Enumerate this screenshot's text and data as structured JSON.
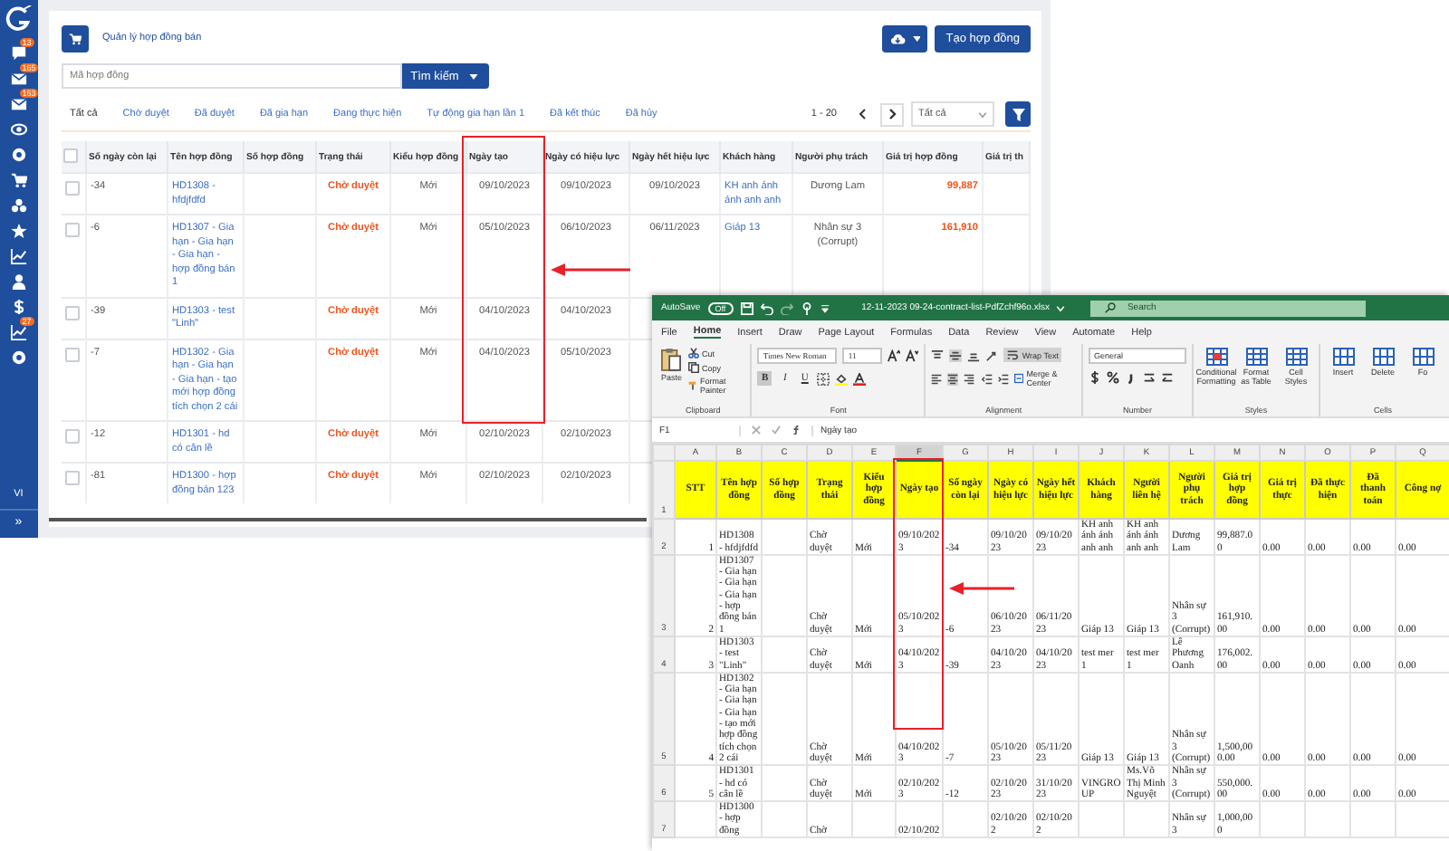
{
  "sidebar": {
    "items": [
      {
        "kind": "chat",
        "badge": "13"
      },
      {
        "kind": "mail",
        "badge": "165"
      },
      {
        "kind": "mail",
        "badge": "163"
      },
      {
        "kind": "eye"
      },
      {
        "kind": "gear"
      },
      {
        "kind": "cart"
      },
      {
        "kind": "group"
      },
      {
        "kind": "star"
      },
      {
        "kind": "chart"
      },
      {
        "kind": "user"
      },
      {
        "kind": "dollar"
      },
      {
        "kind": "chart",
        "badge": "27"
      },
      {
        "kind": "gear"
      }
    ],
    "language": "VI",
    "collapse": "»"
  },
  "page": {
    "title": "Quản lý hợp đồng bán",
    "create_button": "Tạo hợp đồng"
  },
  "search": {
    "placeholder": "Mã hợp đồng",
    "button": "Tìm kiếm"
  },
  "tabs": [
    {
      "label": "Tất cả",
      "selected": true
    },
    {
      "label": "Chờ duyệt",
      "selected": false
    },
    {
      "label": "Đã duyệt",
      "selected": false
    },
    {
      "label": "Đã gia hạn",
      "selected": false
    },
    {
      "label": "Đang thực hiện",
      "selected": false
    },
    {
      "label": "Tự động gia hạn lần 1",
      "selected": false
    },
    {
      "label": "Đã kết thúc",
      "selected": false
    },
    {
      "label": "Đã hủy",
      "selected": false
    }
  ],
  "pagination": {
    "range": "1 - 20",
    "page_size": "Tất cả"
  },
  "table": {
    "select_all_checked": false,
    "columns": [
      "Số ngày còn lại",
      "Tên hợp đồng",
      "Số hợp đồng",
      "Trạng thái",
      "Kiểu hợp đồng",
      "Ngày tạo",
      "Ngày có hiệu lực",
      "Ngày hết hiệu lực",
      "Khách hàng",
      "Người phụ trách",
      "Giá trị hợp đồng",
      "Giá trị th"
    ],
    "rows": [
      {
        "checked": false,
        "days_left": "-34",
        "name": "HD1308 - hfdjfdfd",
        "status": "Chờ duyệt",
        "type": "Mới",
        "created": "09/10/2023",
        "effective": "09/10/2023",
        "expiry": "09/10/2023",
        "customer": "KH anh ánh ánh anh anh",
        "owner": "Dương Lam",
        "value": "99,887"
      },
      {
        "checked": false,
        "days_left": "-6",
        "name": "HD1307 - Gia hạn - Gia hạn - Gia hạn - hợp đồng bán 1",
        "status": "Chờ duyệt",
        "type": "Mới",
        "created": "05/10/2023",
        "effective": "06/10/2023",
        "expiry": "06/11/2023",
        "customer": "Giáp 13",
        "owner": "Nhân sự 3 (Corrupt)",
        "value": "161,910"
      },
      {
        "checked": false,
        "days_left": "-39",
        "name": "HD1303 - test \"Linh\"",
        "status": "Chờ duyệt",
        "type": "Mới",
        "created": "04/10/2023",
        "effective": "04/10/2023"
      },
      {
        "checked": false,
        "days_left": "-7",
        "name": "HD1302 - Gia hạn - Gia hạn - Gia hạn - tạo mới hợp đồng tích chọn 2 cái",
        "status": "Chờ duyệt",
        "type": "Mới",
        "created": "04/10/2023",
        "effective": "05/10/2023"
      },
      {
        "checked": false,
        "days_left": "-12",
        "name": "HD1301 - hd có cân lề",
        "status": "Chờ duyệt",
        "type": "Mới",
        "created": "02/10/2023",
        "effective": "02/10/2023"
      },
      {
        "checked": false,
        "days_left": "-81",
        "name": "HD1300 - hợp đồng bán 123",
        "status": "Chờ duyệt",
        "type": "Mới",
        "created": "02/10/2023",
        "effective": "02/10/2023"
      }
    ]
  },
  "excel": {
    "title_bar": {
      "autosave": {
        "label": "AutoSave",
        "on": false,
        "state_text": "Off"
      },
      "filename": "12-11-2023 09-24-contract-list-PdfZchf96o.xlsx",
      "search_placeholder": "Search"
    },
    "menu": [
      {
        "label": "File",
        "selected": false
      },
      {
        "label": "Home",
        "selected": true
      },
      {
        "label": "Insert",
        "selected": false
      },
      {
        "label": "Draw",
        "selected": false
      },
      {
        "label": "Page Layout",
        "selected": false
      },
      {
        "label": "Formulas",
        "selected": false
      },
      {
        "label": "Data",
        "selected": false
      },
      {
        "label": "Review",
        "selected": false
      },
      {
        "label": "View",
        "selected": false
      },
      {
        "label": "Automate",
        "selected": false
      },
      {
        "label": "Help",
        "selected": false
      }
    ],
    "ribbon": {
      "clipboard": {
        "label": "Clipboard",
        "paste": "Paste",
        "cut": "Cut",
        "copy": "Copy",
        "format_painter": "Format Painter"
      },
      "font": {
        "label": "Font",
        "family": "Times New Roman",
        "size": "11",
        "styles": [
          {
            "label": "B",
            "on": true
          },
          {
            "label": "I",
            "on": false
          },
          {
            "label": "U",
            "on": false
          }
        ]
      },
      "alignment": {
        "label": "Alignment",
        "wrap_text": {
          "label": "Wrap Text",
          "on": true
        },
        "merge": "Merge & Center"
      },
      "number": {
        "label": "Number",
        "format": "General"
      },
      "styles": {
        "label": "Styles",
        "items": [
          "Conditional Formatting",
          "Format as Table",
          "Cell Styles"
        ]
      },
      "cells": {
        "label": "Cells",
        "items": [
          "Insert",
          "Delete",
          "Fo"
        ]
      }
    },
    "name_box": "F1",
    "formula": "Ngày tạo",
    "columns": [
      "A",
      "B",
      "C",
      "D",
      "E",
      "F",
      "G",
      "H",
      "I",
      "J",
      "K",
      "L",
      "M",
      "N",
      "O",
      "P",
      "Q"
    ],
    "header_row": {
      "number": "1",
      "cells": [
        "STT",
        "Tên hợp đồng",
        "Số hợp đồng",
        "Trạng thái",
        "Kiểu hợp đồng",
        "Ngày tạo",
        "Số ngày còn lại",
        "Ngày có hiệu lực",
        "Ngày hết hiệu lực",
        "Khách hàng",
        "Người liên hệ",
        "Người phụ trách",
        "Giá trị hợp đồng",
        "Giá trị thực",
        "Đã thực hiện",
        "Đã thanh toán",
        "Công nợ"
      ]
    },
    "rows": [
      {
        "number": "2",
        "cells": [
          "1",
          "HD1308 - hfdjfdfd",
          null,
          "Chờ duyệt",
          "Mới",
          "09/10/2023",
          "-34",
          "09/10/2023",
          "09/10/2023",
          "KH anh ánh ánh anh anh",
          "KH anh ánh ánh anh anh",
          "Dương Lam",
          "99,887.00",
          "0.00",
          "0.00",
          "0.00",
          "0.00"
        ]
      },
      {
        "number": "3",
        "cells": [
          "2",
          "HD1307 - Gia hạn - Gia hạn - Gia hạn - hợp đồng bán 1",
          null,
          "Chờ duyệt",
          "Mới",
          "05/10/2023",
          "-6",
          "06/10/2023",
          "06/11/2023",
          "Giáp 13",
          "Giáp 13",
          "Nhân sự 3 (Corrupt)",
          "161,910.00",
          "0.00",
          "0.00",
          "0.00",
          "0.00"
        ]
      },
      {
        "number": "4",
        "cells": [
          "3",
          "HD1303 - test \"Linh\"",
          null,
          "Chờ duyệt",
          "Mới",
          "04/10/2023",
          "-39",
          "04/10/2023",
          "04/10/2023",
          "test mer 1",
          "test mer 1",
          "Lê Phương Oanh",
          "176,002.00",
          "0.00",
          "0.00",
          "0.00",
          "0.00"
        ]
      },
      {
        "number": "5",
        "cells": [
          "4",
          "HD1302 - Gia hạn - Gia hạn - Gia hạn - tạo mới hợp đồng tích chọn 2 cái",
          null,
          "Chờ duyệt",
          "Mới",
          "04/10/2023",
          "-7",
          "05/10/2023",
          "05/11/2023",
          "Giáp 13",
          "Giáp 13",
          "Nhân sự 3 (Corrupt)",
          "1,500,000.00",
          "0.00",
          "0.00",
          "0.00",
          "0.00"
        ]
      },
      {
        "number": "6",
        "cells": [
          "5",
          "HD1301 - hd có cân lề",
          null,
          "Chờ duyệt",
          "Mới",
          "02/10/2023",
          "-12",
          "02/10/2023",
          "31/10/2023",
          "VINGROUP",
          "Ms.Võ Thị Minh Nguyệt",
          "Nhân sự 3 (Corrupt)",
          "550,000.00",
          "0.00",
          "0.00",
          "0.00",
          "0.00"
        ]
      },
      {
        "number": "7",
        "cells": [
          null,
          "HD1300 - hợp đồng",
          null,
          "Chờ",
          null,
          "02/10/202",
          null,
          "02/10/202",
          "02/10/202",
          null,
          null,
          "Nhân sự 3",
          "1,000,000",
          null,
          null,
          null,
          null
        ]
      }
    ]
  }
}
